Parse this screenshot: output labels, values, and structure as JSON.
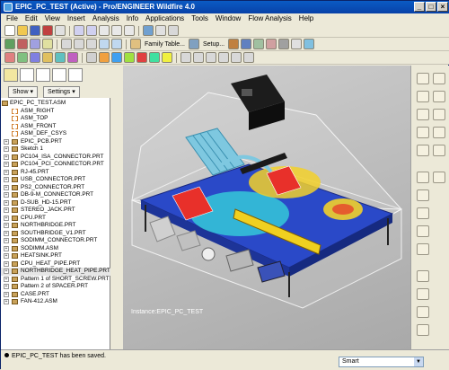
{
  "window": {
    "title": "EPIC_PC_TEST (Active) - Pro/ENGINEER Wildfire 4.0"
  },
  "menu": [
    "File",
    "Edit",
    "View",
    "Insert",
    "Analysis",
    "Info",
    "Applications",
    "Tools",
    "Window",
    "Flow Analysis",
    "Help"
  ],
  "toolbar": {
    "family_table_label": "Family Table...",
    "setup_label": "Setup..."
  },
  "navigator": {
    "show_label": "Show ▾",
    "settings_label": "Settings ▾",
    "tree": [
      {
        "label": "EPIC_PC_TEST.ASM",
        "kind": "root"
      },
      {
        "label": "ASM_RIGHT",
        "kind": "plane"
      },
      {
        "label": "ASM_TOP",
        "kind": "plane"
      },
      {
        "label": "ASM_FRONT",
        "kind": "plane"
      },
      {
        "label": "ASM_DEF_CSYS",
        "kind": "plane"
      },
      {
        "label": "EPIC_PCB.PRT",
        "kind": "part"
      },
      {
        "label": "Sketch 1",
        "kind": "part"
      },
      {
        "label": "PC104_ISA_CONNECTOR.PRT",
        "kind": "part"
      },
      {
        "label": "PC104_PCI_CONNECTOR.PRT",
        "kind": "part"
      },
      {
        "label": "RJ-45.PRT",
        "kind": "part"
      },
      {
        "label": "USB_CONNECTOR.PRT",
        "kind": "part"
      },
      {
        "label": "PS2_CONNECTOR.PRT",
        "kind": "part"
      },
      {
        "label": "DB-9-M_CONNECTOR.PRT",
        "kind": "part"
      },
      {
        "label": "D-SUB_HD-15.PRT",
        "kind": "part"
      },
      {
        "label": "STEREO_JACK.PRT",
        "kind": "part"
      },
      {
        "label": "CPU.PRT",
        "kind": "part"
      },
      {
        "label": "NORTHBRIDGE.PRT",
        "kind": "part"
      },
      {
        "label": "SOUTHBRIDGE_V1.PRT",
        "kind": "part"
      },
      {
        "label": "SODIMM_CONNECTOR.PRT",
        "kind": "part"
      },
      {
        "label": "SODIMM.ASM",
        "kind": "part"
      },
      {
        "label": "HEATSINK.PRT",
        "kind": "part"
      },
      {
        "label": "CPU_HEAT_PIPE.PRT",
        "kind": "part"
      },
      {
        "label": "NORTHBRIDGE_HEAT_PIPE.PRT",
        "kind": "sel"
      },
      {
        "label": "Pattern 1 of SHORT_SCREW.PRT",
        "kind": "part"
      },
      {
        "label": "Pattern 2 of SPACER.PRT",
        "kind": "part"
      },
      {
        "label": "CASE.PRT",
        "kind": "part"
      },
      {
        "label": "FAN-412.ASM",
        "kind": "part"
      }
    ]
  },
  "viewport": {
    "instance_label": "Instance:EPIC_PC_TEST"
  },
  "status": {
    "message": "EPIC_PC_TEST has been saved.",
    "filter": "Smart"
  },
  "colors": {
    "accent": "#0a5bc4",
    "board": "#2a49c8",
    "hot": "#e8302a",
    "warm": "#f2d02a",
    "cool": "#35c8d8"
  }
}
